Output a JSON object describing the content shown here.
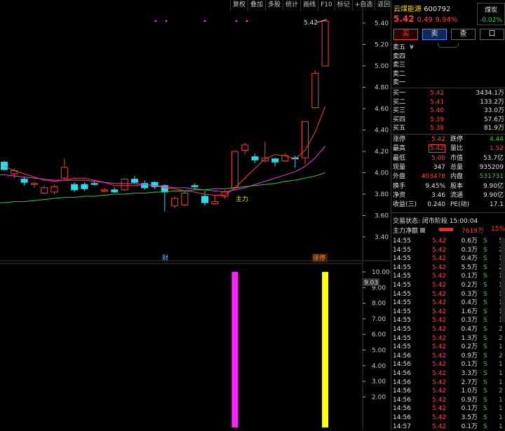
{
  "toolbar": {
    "buttons": [
      "复权",
      "叠加",
      "多股",
      "统计",
      "画线",
      "F10",
      "标记",
      "+自选",
      "返回"
    ]
  },
  "stock": {
    "name": "云煤能源",
    "code": "600792",
    "price": "5.42",
    "change": "0.49",
    "change_pct": "9.94%",
    "sector": "煤炭",
    "sector_pct": "-0.02%",
    "buttons": {
      "buy": "买",
      "sell": "卖",
      "watch": "查",
      "cart": "口"
    }
  },
  "order_book": {
    "asks": [
      {
        "label": "卖五",
        "price": "",
        "vol": "",
        "mark": "¥"
      },
      {
        "label": "卖四",
        "price": "",
        "vol": ""
      },
      {
        "label": "卖三",
        "price": "",
        "vol": ""
      },
      {
        "label": "卖二",
        "price": "",
        "vol": ""
      },
      {
        "label": "卖一",
        "price": "",
        "vol": ""
      }
    ],
    "bids": [
      {
        "label": "买一",
        "price": "5.42",
        "vol": "3434.1万"
      },
      {
        "label": "买二",
        "price": "5.41",
        "vol": "133.2万"
      },
      {
        "label": "买三",
        "price": "5.40",
        "vol": "33.0万"
      },
      {
        "label": "买四",
        "price": "5.39",
        "vol": "57.6万"
      },
      {
        "label": "买五",
        "price": "5.38",
        "vol": "81.9万"
      }
    ]
  },
  "stats": {
    "rows": [
      {
        "l1": "涨停",
        "v1": "5.42",
        "c1": "red",
        "l2": "跌停",
        "v2": "4.44",
        "c2": "green"
      },
      {
        "l1": "最高",
        "v1": "5.42",
        "c1": "red",
        "l2": "量比",
        "v2": "1.52",
        "c2": "red"
      },
      {
        "l1": "最低",
        "v1": "5.00",
        "c1": "red",
        "l2": "市值",
        "v2": "53.7亿",
        "c2": "white"
      },
      {
        "l1": "现量",
        "v1": "347",
        "c1": "white",
        "l2": "总量",
        "v2": "935209",
        "c2": "white"
      },
      {
        "l1": "外盘",
        "v1": "403478",
        "c1": "red",
        "l2": "内盘",
        "v2": "531731",
        "c2": "green"
      },
      {
        "l1": "换手",
        "v1": "9.45%",
        "c1": "white",
        "l2": "股本",
        "v2": "9.90亿",
        "c2": "white"
      },
      {
        "l1": "净资",
        "v1": "3.46",
        "c1": "white",
        "l2": "流通",
        "v2": "9.90亿",
        "c2": "white"
      },
      {
        "l1": "收益(三)",
        "v1": "0.240",
        "c1": "white",
        "l2": "PE(动)",
        "v2": "17.1",
        "c2": "white"
      }
    ],
    "status": "交易状态: 闭市阶段 15:00:04",
    "main_net": {
      "label": "主力净额",
      "value": "7619万",
      "pct": "15%"
    }
  },
  "ticks": [
    {
      "time": "14:55",
      "price": "5.42",
      "vol": "0.6万",
      "side": "S",
      "n": "5"
    },
    {
      "time": "14:55",
      "price": "5.42",
      "vol": "0.3万",
      "side": "S",
      "n": "2"
    },
    {
      "time": "14:55",
      "price": "5.42",
      "vol": "0.4万",
      "side": "S",
      "n": "1"
    },
    {
      "time": "14:55",
      "price": "5.42",
      "vol": "5.5万",
      "side": "S",
      "n": "2"
    },
    {
      "time": "14:55",
      "price": "5.42",
      "vol": "0.1万",
      "side": "S",
      "n": "1"
    },
    {
      "time": "14:55",
      "price": "5.42",
      "vol": "0.2万",
      "side": "S",
      "n": "1"
    },
    {
      "time": "14:55",
      "price": "5.42",
      "vol": "0.3万",
      "side": "S",
      "n": "1"
    },
    {
      "time": "14:55",
      "price": "5.42",
      "vol": "0.4万",
      "side": "S",
      "n": "1"
    },
    {
      "time": "14:55",
      "price": "5.42",
      "vol": "1.6万",
      "side": "S",
      "n": "1"
    },
    {
      "time": "14:55",
      "price": "5.42",
      "vol": "0.3万",
      "side": "S",
      "n": "1"
    },
    {
      "time": "14:55",
      "price": "5.42",
      "vol": "0.4万",
      "side": "S",
      "n": "2"
    },
    {
      "time": "14:55",
      "price": "5.42",
      "vol": "1.3万",
      "side": "S",
      "n": "2"
    },
    {
      "time": "14:55",
      "price": "5.42",
      "vol": "0.2万",
      "side": "S",
      "n": "1"
    },
    {
      "time": "14:56",
      "price": "5.42",
      "vol": "0.9万",
      "side": "S",
      "n": "2"
    },
    {
      "time": "14:56",
      "price": "5.42",
      "vol": "0.1万",
      "side": "S",
      "n": "1"
    },
    {
      "time": "14:56",
      "price": "5.42",
      "vol": "3.3万",
      "side": "S",
      "n": "1"
    },
    {
      "time": "14:56",
      "price": "5.42",
      "vol": "2.7万",
      "side": "S",
      "n": "1"
    },
    {
      "time": "14:56",
      "price": "5.42",
      "vol": "1.0万",
      "side": "S",
      "n": "2"
    },
    {
      "time": "14:56",
      "price": "5.42",
      "vol": "0.9万",
      "side": "S",
      "n": "1"
    },
    {
      "time": "14:56",
      "price": "5.42",
      "vol": "0.1万",
      "side": "S",
      "n": "1"
    },
    {
      "time": "14:56",
      "price": "5.42",
      "vol": "3.5万",
      "side": "S",
      "n": "1"
    },
    {
      "time": "14:57",
      "price": "5.42",
      "vol": "0.1万",
      "side": "S",
      "n": "1"
    }
  ],
  "chart_data": {
    "type": "candlestick",
    "price_axis": {
      "ticks": [
        5.4,
        5.2,
        5.0,
        4.8,
        4.6,
        4.4,
        4.2,
        4.0,
        3.8,
        3.6,
        3.4
      ]
    },
    "last_price_label": "5.42",
    "candles": [
      [
        4.1,
        4.03,
        4.11,
        4.02
      ],
      [
        3.99,
        4.02,
        4.04,
        3.95
      ],
      [
        3.94,
        3.91,
        3.96,
        3.88
      ],
      [
        3.89,
        3.9,
        3.91,
        3.86
      ],
      [
        3.81,
        3.86,
        3.88,
        3.8
      ],
      [
        3.82,
        3.87,
        3.89,
        3.8
      ],
      [
        3.95,
        4.05,
        4.13,
        3.93
      ],
      [
        3.89,
        3.84,
        3.91,
        3.82
      ],
      [
        3.89,
        3.85,
        3.91,
        3.83
      ],
      [
        3.9,
        3.89,
        3.93,
        3.88
      ],
      [
        3.83,
        3.84,
        3.86,
        3.82
      ],
      [
        3.84,
        3.82,
        3.86,
        3.81
      ],
      [
        3.84,
        3.94,
        3.95,
        3.83
      ],
      [
        3.94,
        3.91,
        3.97,
        3.9
      ],
      [
        3.9,
        3.86,
        3.93,
        3.84
      ],
      [
        3.91,
        3.87,
        3.92,
        3.85
      ],
      [
        3.88,
        3.82,
        3.89,
        3.64
      ],
      [
        3.69,
        3.76,
        3.78,
        3.67
      ],
      [
        3.7,
        3.81,
        3.83,
        3.69
      ],
      [
        3.88,
        3.87,
        3.9,
        3.84
      ],
      [
        3.78,
        3.72,
        3.83,
        3.69
      ],
      [
        3.71,
        3.73,
        3.79,
        3.7
      ],
      [
        3.78,
        3.82,
        3.84,
        3.76
      ],
      [
        3.86,
        4.2,
        4.21,
        3.84
      ],
      [
        4.21,
        4.26,
        4.28,
        4.17
      ],
      [
        4.15,
        4.12,
        4.18,
        4.09
      ],
      [
        4.11,
        4.14,
        4.29,
        4.1
      ],
      [
        4.13,
        4.1,
        4.14,
        4.06
      ],
      [
        4.11,
        4.16,
        4.18,
        4.1
      ],
      [
        4.14,
        4.13,
        4.16,
        4.05
      ],
      [
        4.14,
        4.48,
        4.48,
        4.08
      ],
      [
        4.61,
        4.93,
        4.96,
        4.6
      ],
      [
        5.0,
        5.42,
        5.42,
        5.0
      ]
    ],
    "ma": [
      {
        "name": "MA5",
        "color": "#ff3b3b",
        "values": [
          4.06,
          4.02,
          3.99,
          3.96,
          3.93,
          3.92,
          3.93,
          3.95,
          3.95,
          3.93,
          3.91,
          3.88,
          3.88,
          3.88,
          3.89,
          3.88,
          3.86,
          3.85,
          3.83,
          3.82,
          3.8,
          3.79,
          3.79,
          3.86,
          3.95,
          4.04,
          4.13,
          4.17,
          4.16,
          4.13,
          4.21,
          4.38,
          4.62
        ]
      },
      {
        "name": "MA10",
        "color": "#ee33ee",
        "values": [
          3.98,
          3.97,
          3.96,
          3.95,
          3.94,
          3.93,
          3.93,
          3.93,
          3.93,
          3.92,
          3.91,
          3.9,
          3.9,
          3.9,
          3.89,
          3.88,
          3.87,
          3.86,
          3.86,
          3.85,
          3.84,
          3.83,
          3.82,
          3.84,
          3.86,
          3.89,
          3.92,
          3.95,
          3.98,
          4.01,
          4.06,
          4.14,
          4.25
        ]
      },
      {
        "name": "MA30",
        "color": "#33cc33",
        "values": [
          3.72,
          3.73,
          3.73,
          3.74,
          3.75,
          3.76,
          3.77,
          3.77,
          3.78,
          3.78,
          3.79,
          3.8,
          3.8,
          3.81,
          3.81,
          3.82,
          3.82,
          3.83,
          3.83,
          3.84,
          3.84,
          3.85,
          3.85,
          3.86,
          3.87,
          3.88,
          3.89,
          3.9,
          3.92,
          3.93,
          3.95,
          3.97,
          4.0
        ]
      }
    ],
    "annotations": {
      "main": "主力",
      "cai": "财",
      "zt": "涨停"
    },
    "volume": {
      "ticks": [
        10.0,
        9.0,
        8.0,
        7.0,
        6.0,
        5.0,
        4.0,
        3.0,
        2.0
      ],
      "current_label": "9.03",
      "bars": [
        {
          "index": 23,
          "value": 10.0,
          "color": "#ff22ff"
        },
        {
          "index": 32,
          "value": 10.0,
          "color": "#ffff00"
        }
      ]
    }
  }
}
